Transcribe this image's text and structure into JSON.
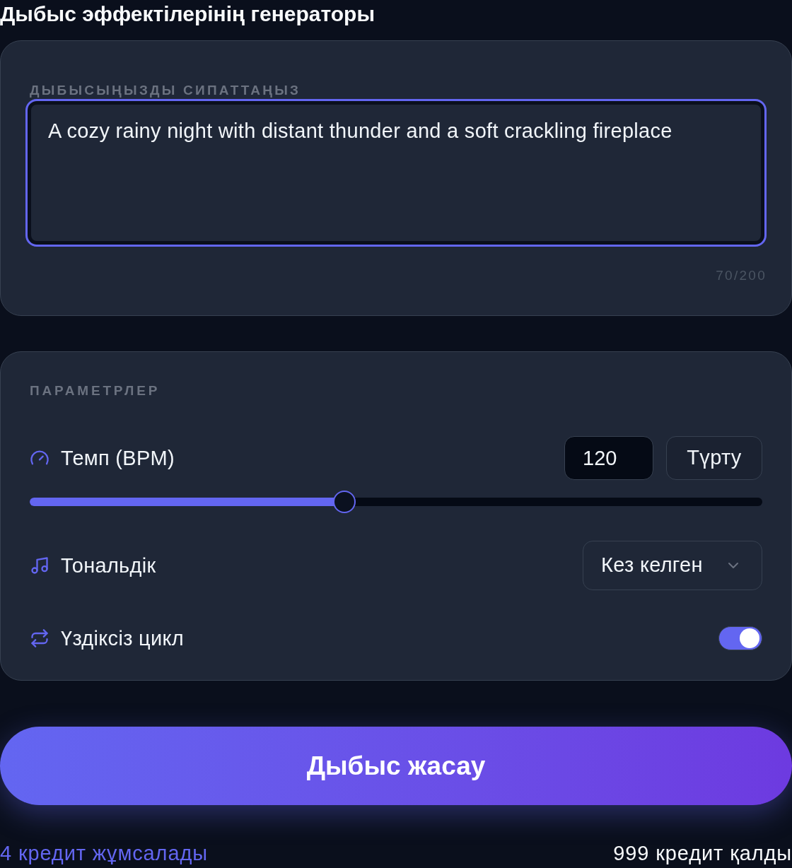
{
  "title": "Дыбыс эффектілерінің генераторы",
  "description": {
    "label": "ДЫБЫСЫҢЫЗДЫ СИПАТТАҢЫЗ",
    "value": "A cozy rainy night with distant thunder and a soft crackling fireplace",
    "counter": "70/200"
  },
  "parameters": {
    "heading": "ПАРАМЕТРЛЕР",
    "rows": [
      {
        "kind": "tempo",
        "label": "Темп (BPM)",
        "value": "120",
        "button": "Түрту",
        "level": 0.43
      },
      {
        "kind": "select",
        "label": "Тональдік",
        "value": "Кез келген"
      },
      {
        "kind": "toggle",
        "label": "Үздіксіз цикл",
        "on": true
      }
    ]
  },
  "generate_button": "Дыбыс жасау",
  "footer": {
    "cost": "4 кредит жұмсалады",
    "remaining": "999 кредит қалды"
  }
}
